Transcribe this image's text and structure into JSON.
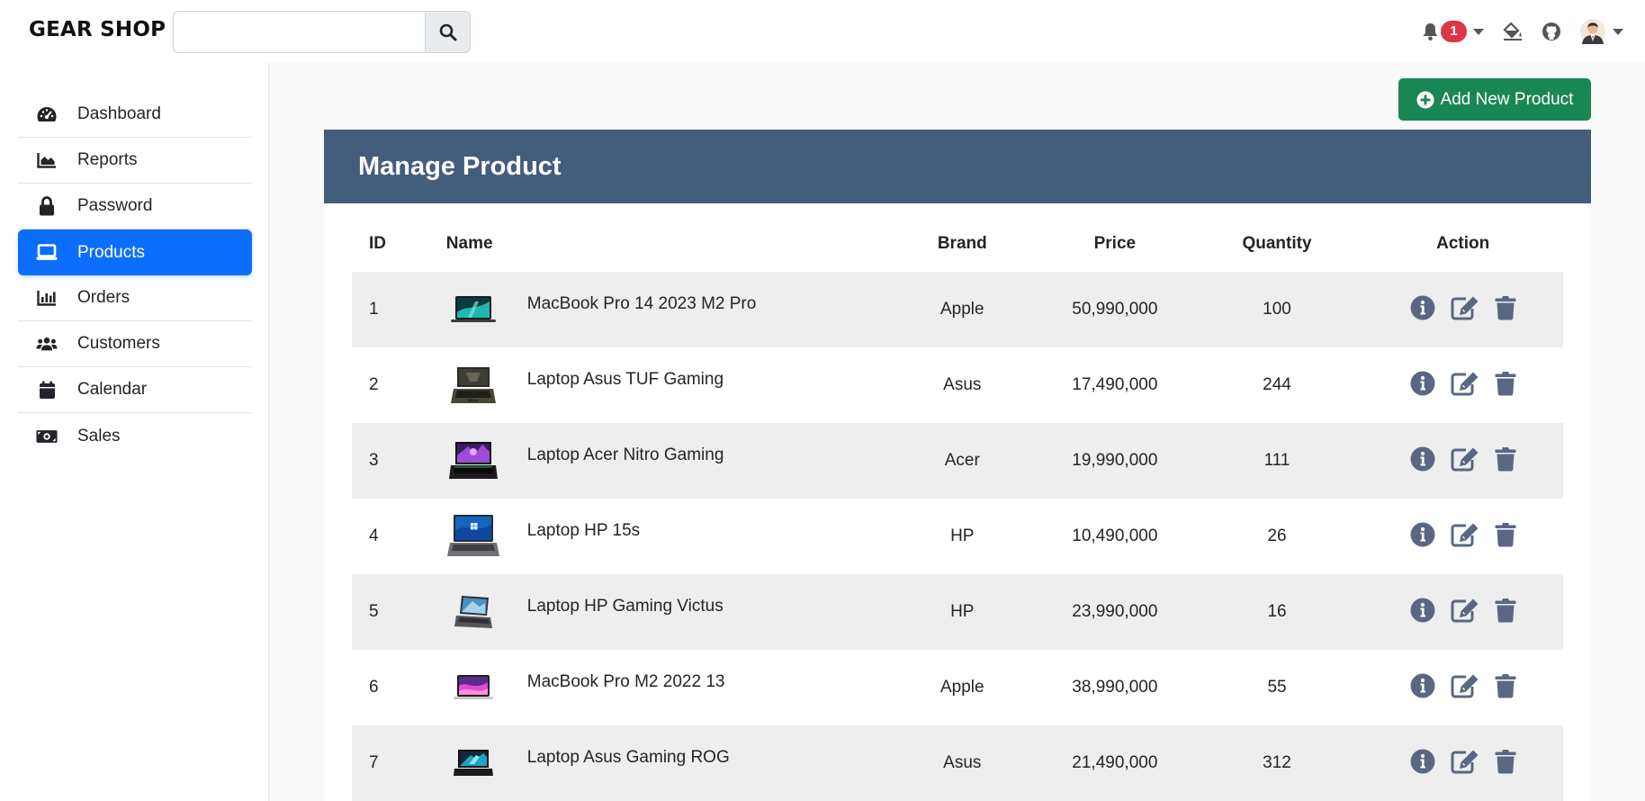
{
  "brand": "GEAR SHOP",
  "search": {
    "placeholder": "",
    "value": ""
  },
  "notifications": {
    "count": "1"
  },
  "sidebar": {
    "items": [
      {
        "label": "Dashboard",
        "icon": "gauge-icon"
      },
      {
        "label": "Reports",
        "icon": "area-chart-icon"
      },
      {
        "label": "Password",
        "icon": "lock-icon"
      },
      {
        "label": "Products",
        "icon": "laptop-icon"
      },
      {
        "label": "Orders",
        "icon": "bar-chart-icon"
      },
      {
        "label": "Customers",
        "icon": "users-icon"
      },
      {
        "label": "Calendar",
        "icon": "calendar-icon"
      },
      {
        "label": "Sales",
        "icon": "money-bill-icon"
      }
    ],
    "active": "Products"
  },
  "add_button": {
    "label": "Add New Product"
  },
  "panel": {
    "title_regular": "Manage ",
    "title_bold": "Product"
  },
  "table": {
    "headers": {
      "id": "ID",
      "name": "Name",
      "brand": "Brand",
      "price": "Price",
      "quantity": "Quantity",
      "action": "Action"
    },
    "rows": [
      {
        "id": "1",
        "name": "MacBook Pro 14 2023 M2 Pro",
        "brand": "Apple",
        "price": "50,990,000",
        "quantity": "100",
        "thumb": "macbook-dark"
      },
      {
        "id": "2",
        "name": "Laptop Asus TUF Gaming",
        "brand": "Asus",
        "price": "17,490,000",
        "quantity": "244",
        "thumb": "tuf"
      },
      {
        "id": "3",
        "name": "Laptop Acer Nitro Gaming",
        "brand": "Acer",
        "price": "19,990,000",
        "quantity": "111",
        "thumb": "nitro"
      },
      {
        "id": "4",
        "name": "Laptop HP 15s",
        "brand": "HP",
        "price": "10,490,000",
        "quantity": "26",
        "thumb": "hp15s"
      },
      {
        "id": "5",
        "name": "Laptop HP Gaming Victus",
        "brand": "HP",
        "price": "23,990,000",
        "quantity": "16",
        "thumb": "victus"
      },
      {
        "id": "6",
        "name": "MacBook Pro M2 2022 13",
        "brand": "Apple",
        "price": "38,990,000",
        "quantity": "55",
        "thumb": "macbook-pink"
      },
      {
        "id": "7",
        "name": "Laptop Asus Gaming ROG",
        "brand": "Asus",
        "price": "21,490,000",
        "quantity": "312",
        "thumb": "rog"
      }
    ]
  },
  "colors": {
    "accent": "#0d6efd",
    "success": "#198754",
    "panel_header": "#435d7d",
    "action_icon": "#5b6782",
    "badge": "#dc3545"
  }
}
